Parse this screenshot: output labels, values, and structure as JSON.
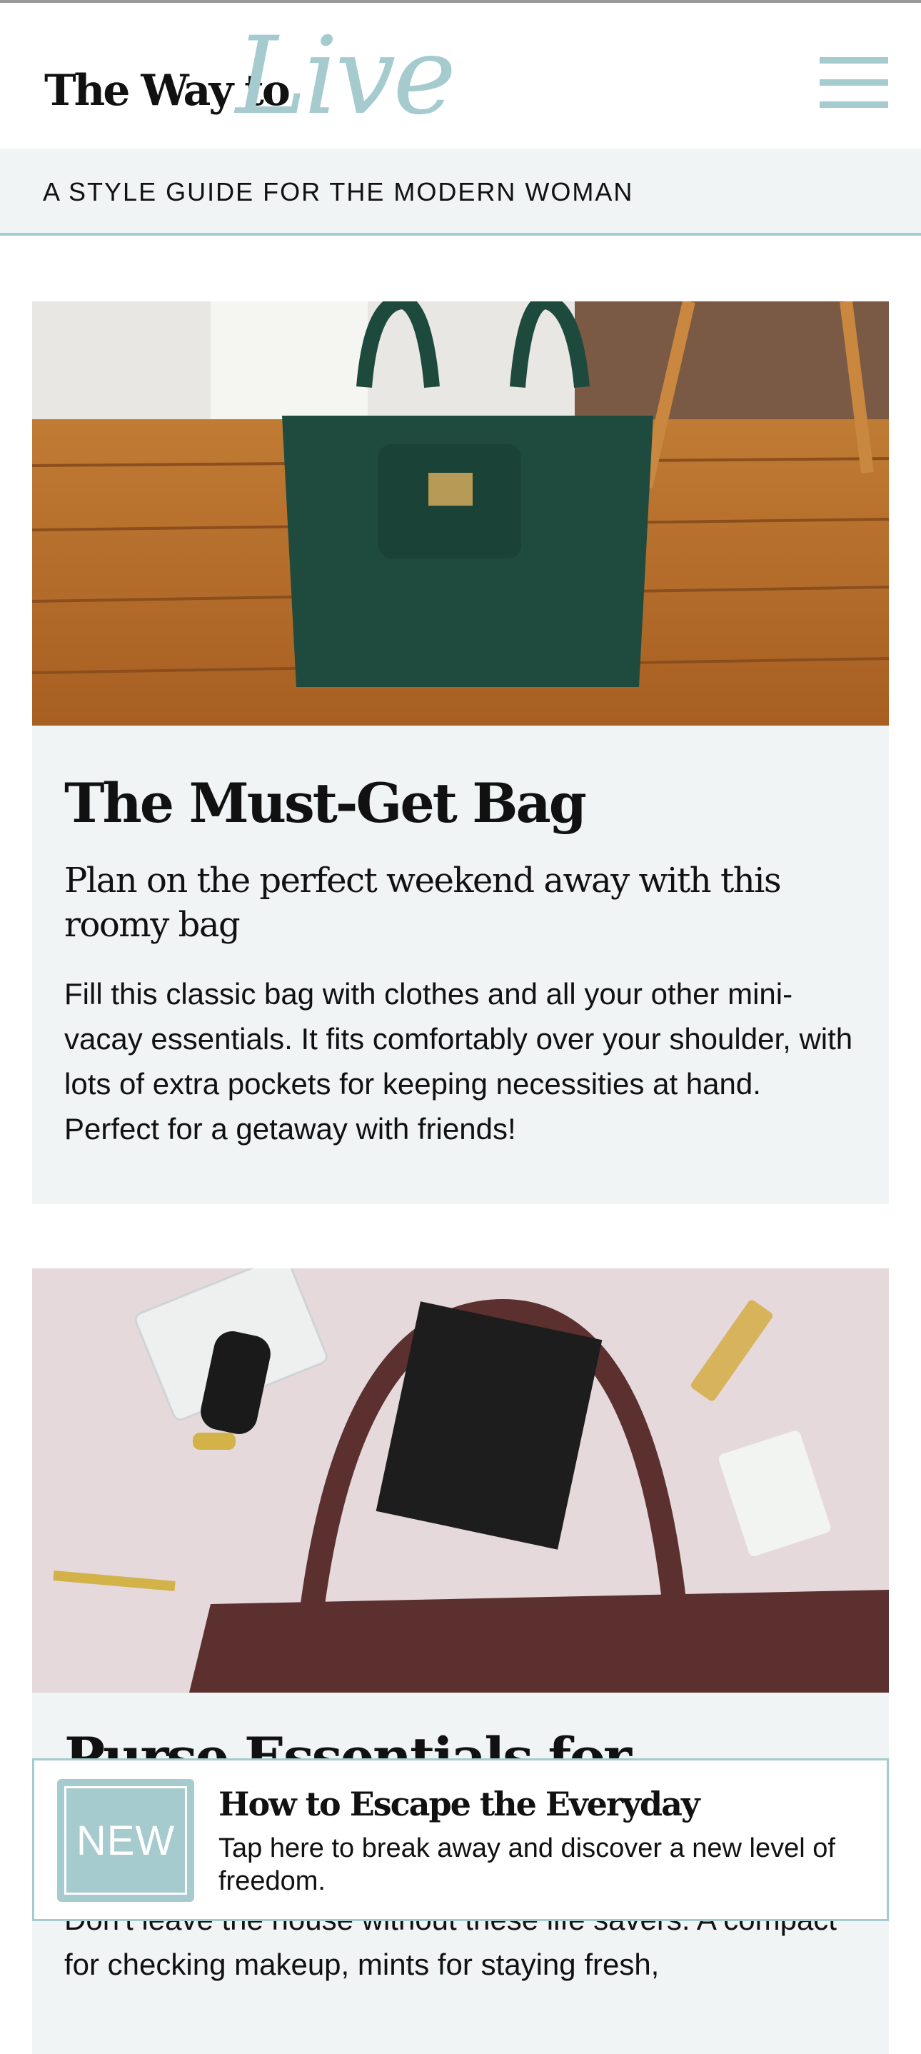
{
  "header": {
    "logo_main": "The Way to",
    "logo_script": "Live",
    "tagline": "A STYLE GUIDE FOR THE MODERN WOMAN"
  },
  "articles": [
    {
      "title": "The Must-Get Bag",
      "subtitle": "Plan on the perfect weekend away with this roomy bag",
      "body": "Fill this classic bag with clothes and all your other mini-vacay essentials. It fits comfortably over your shoulder, with lots of extra pockets for keeping necessities at hand. Perfect for a getaway with friends!"
    },
    {
      "title": "Purse Essentials for",
      "body": "Don't leave the house without these life savers. A compact for checking makeup, mints for staying fresh,"
    }
  ],
  "promo": {
    "badge": "NEW",
    "title": "How to Escape the Everyday",
    "text": "Tap here to break away and discover a new level of freedom."
  },
  "icons": [
    "menu-icon"
  ],
  "colors": {
    "accent": "#a6cbcf",
    "panel": "#f0f4f5",
    "text": "#111111"
  }
}
